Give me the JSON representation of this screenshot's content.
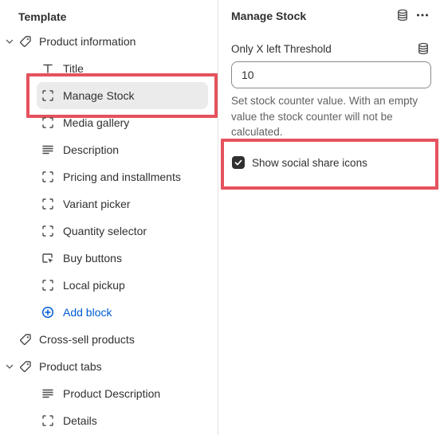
{
  "sidebar": {
    "section_title": "Template",
    "groups": [
      {
        "label": "Product information",
        "icon": "tag-icon",
        "expanded": true,
        "blocks": [
          {
            "label": "Title",
            "icon": "text-icon"
          },
          {
            "label": "Manage Stock",
            "icon": "dashed-block-icon",
            "selected": true
          },
          {
            "label": "Media gallery",
            "icon": "dashed-block-icon"
          },
          {
            "label": "Description",
            "icon": "paragraph-icon"
          },
          {
            "label": "Pricing and installments",
            "icon": "dashed-block-icon"
          },
          {
            "label": "Variant picker",
            "icon": "dashed-block-icon"
          },
          {
            "label": "Quantity selector",
            "icon": "dashed-block-icon"
          },
          {
            "label": "Buy buttons",
            "icon": "cursor-block-icon"
          },
          {
            "label": "Local pickup",
            "icon": "dashed-block-icon"
          }
        ],
        "add_block_label": "Add block"
      },
      {
        "label": "Cross-sell products",
        "icon": "tag-icon"
      },
      {
        "label": "Product tabs",
        "icon": "tag-icon",
        "expanded": true,
        "blocks": [
          {
            "label": "Product Description",
            "icon": "paragraph-icon"
          },
          {
            "label": "Details",
            "icon": "dashed-block-icon"
          }
        ]
      }
    ]
  },
  "panel": {
    "title": "Manage Stock",
    "field": {
      "label": "Only X left Threshold",
      "value": "10",
      "help": "Set stock counter value. With an empty value the stock counter will not be calculated."
    },
    "checkbox": {
      "label": "Show social share icons",
      "checked": true
    }
  },
  "colors": {
    "highlight": "#e5525d",
    "link": "#005bd3",
    "selected_bg": "#ebebeb",
    "text": "#303030",
    "muted": "#616161"
  }
}
